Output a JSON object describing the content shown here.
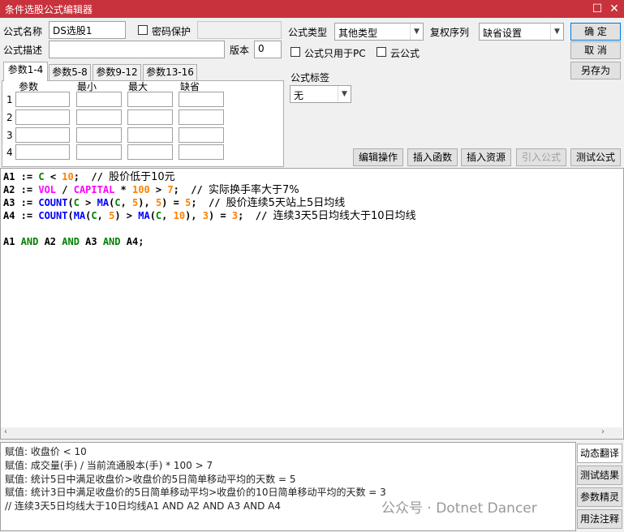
{
  "window": {
    "title": "条件选股公式编辑器",
    "minimize_icon": "minimize-icon",
    "close_icon": "close-icon"
  },
  "form": {
    "name_label": "公式名称",
    "name_value": "DS选股1",
    "password_label": "密码保护",
    "desc_label": "公式描述",
    "desc_value": "",
    "version_label": "版本",
    "version_value": "0",
    "type_label": "公式类型",
    "type_value": "其他类型",
    "rights_label": "复权序列",
    "rights_value": "缺省设置",
    "pc_only_label": "公式只用于PC",
    "cloud_label": "云公式",
    "tag_label": "公式标签",
    "tag_value": "无"
  },
  "buttons": {
    "ok": "确  定",
    "cancel": "取  消",
    "save_as": "另存为",
    "edit_ops": "编辑操作",
    "insert_func": "插入函数",
    "insert_res": "插入资源",
    "import_formula": "引入公式",
    "test_formula": "测试公式"
  },
  "tabs": [
    "参数1-4",
    "参数5-8",
    "参数9-12",
    "参数13-16"
  ],
  "params": {
    "headers": [
      "参数",
      "最小",
      "最大",
      "缺省"
    ],
    "rows": [
      "1",
      "2",
      "3",
      "4"
    ]
  },
  "code": {
    "line1": {
      "var": "A1",
      "op": " := ",
      "a": "C",
      "b": " < ",
      "n": "10",
      "end": ";  // ",
      "comment": "股价低于10元"
    },
    "line2": {
      "var": "A2",
      "op": " := ",
      "a": "VOL",
      "b": " / ",
      "c": "CAPITAL",
      "d": " * ",
      "n1": "100",
      "e": " > ",
      "n2": "7",
      "end": ";  // ",
      "comment": "实际换手率大于7%"
    },
    "line3": {
      "var": "A3",
      "op": " := ",
      "f1": "COUNT",
      "p1": "(",
      "a": "C",
      "b": " > ",
      "f2": "MA",
      "p2": "(",
      "c": "C",
      "s1": ", ",
      "n1": "5",
      "s2": "), ",
      "n2": "5",
      "p3": ") = ",
      "n3": "5",
      "end": ";  // ",
      "comment": "股价连续5天站上5日均线"
    },
    "line4": {
      "var": "A4",
      "op": " := ",
      "f1": "COUNT",
      "p1": "(",
      "f2": "MA",
      "p2": "(",
      "a": "C",
      "s1": ", ",
      "n1": "5",
      "p3": ") > ",
      "f3": "MA",
      "p4": "(",
      "b": "C",
      "s2": ", ",
      "n2": "10",
      "p5": "), ",
      "n3": "3",
      "p6": ") = ",
      "n4": "3",
      "end": ";  // ",
      "comment": "连续3天5日均线大于10日均线"
    },
    "line5": {
      "v1": "A1",
      "k1": " AND ",
      "v2": "A2",
      "k2": " AND ",
      "v3": "A3",
      "k3": " AND ",
      "v4": "A4",
      "end": ";"
    }
  },
  "output": {
    "lines": [
      "赋值: 收盘价 < 10",
      "赋值: 成交量(手) / 当前流通股本(手) * 100 > 7",
      "赋值: 统计5日中满足收盘价>收盘价的5日简单移动平均的天数 = 5",
      "赋值: 统计3日中满足收盘价的5日简单移动平均>收盘价的10日简单移动平均的天数 = 3",
      " // 连续3天5日均线大于10日均线A1 AND A2 AND A3 AND A4"
    ]
  },
  "side_buttons": [
    "动态翻译",
    "测试结果",
    "参数精灵",
    "用法注释"
  ],
  "watermark": "公众号 · Dotnet Dancer",
  "colors": {
    "title_bar": "#c8323c",
    "var": "#000000",
    "keyword": "#008000",
    "function": "#0000ff",
    "number": "#ff8000",
    "variable": "#ff00ff"
  }
}
